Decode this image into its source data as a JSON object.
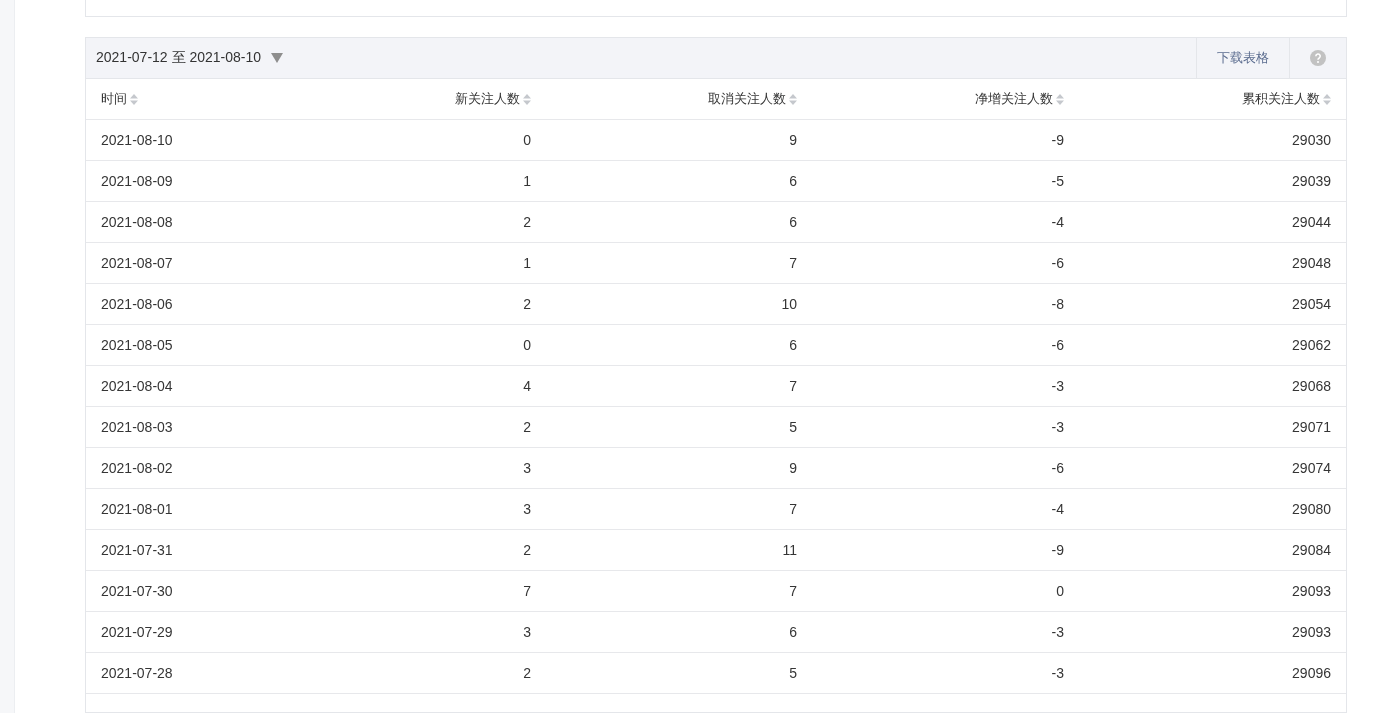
{
  "date_range": {
    "label": "2021-07-12 至 2021-08-10"
  },
  "actions": {
    "download": "下载表格"
  },
  "table": {
    "columns": [
      "时间",
      "新关注人数",
      "取消关注人数",
      "净增关注人数",
      "累积关注人数"
    ],
    "rows": [
      [
        "2021-08-10",
        "0",
        "9",
        "-9",
        "29030"
      ],
      [
        "2021-08-09",
        "1",
        "6",
        "-5",
        "29039"
      ],
      [
        "2021-08-08",
        "2",
        "6",
        "-4",
        "29044"
      ],
      [
        "2021-08-07",
        "1",
        "7",
        "-6",
        "29048"
      ],
      [
        "2021-08-06",
        "2",
        "10",
        "-8",
        "29054"
      ],
      [
        "2021-08-05",
        "0",
        "6",
        "-6",
        "29062"
      ],
      [
        "2021-08-04",
        "4",
        "7",
        "-3",
        "29068"
      ],
      [
        "2021-08-03",
        "2",
        "5",
        "-3",
        "29071"
      ],
      [
        "2021-08-02",
        "3",
        "9",
        "-6",
        "29074"
      ],
      [
        "2021-08-01",
        "3",
        "7",
        "-4",
        "29080"
      ],
      [
        "2021-07-31",
        "2",
        "11",
        "-9",
        "29084"
      ],
      [
        "2021-07-30",
        "7",
        "7",
        "0",
        "29093"
      ],
      [
        "2021-07-29",
        "3",
        "6",
        "-3",
        "29093"
      ],
      [
        "2021-07-28",
        "2",
        "5",
        "-3",
        "29096"
      ]
    ]
  }
}
